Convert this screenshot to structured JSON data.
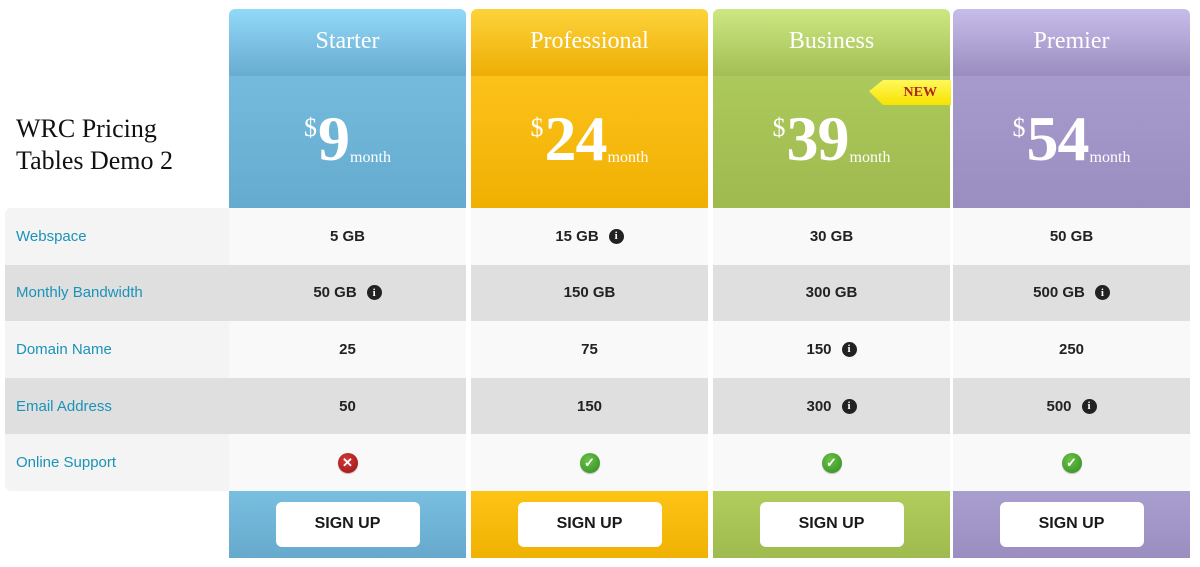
{
  "page": {
    "title": "WRC Pricing Tables Demo 2"
  },
  "features": [
    {
      "label": "Webspace"
    },
    {
      "label": "Monthly Bandwidth"
    },
    {
      "label": "Domain Name"
    },
    {
      "label": "Email Address"
    },
    {
      "label": "Online Support"
    }
  ],
  "plans": [
    {
      "name": "Starter",
      "currency": "$",
      "price": "9",
      "period": "month",
      "badge": "",
      "values": [
        {
          "text": "5 GB",
          "info": false
        },
        {
          "text": "50 GB",
          "info": true
        },
        {
          "text": "25",
          "info": false
        },
        {
          "text": "50",
          "info": false
        },
        {
          "status": "no"
        }
      ],
      "button_label": "SIGN UP"
    },
    {
      "name": "Professional",
      "currency": "$",
      "price": "24",
      "period": "month",
      "badge": "",
      "values": [
        {
          "text": "15 GB",
          "info": true
        },
        {
          "text": "150 GB",
          "info": false
        },
        {
          "text": "75",
          "info": false
        },
        {
          "text": "150",
          "info": false
        },
        {
          "status": "yes"
        }
      ],
      "button_label": "SIGN UP"
    },
    {
      "name": "Business",
      "currency": "$",
      "price": "39",
      "period": "month",
      "badge": "NEW",
      "values": [
        {
          "text": "30 GB",
          "info": false
        },
        {
          "text": "300 GB",
          "info": false
        },
        {
          "text": "150",
          "info": true
        },
        {
          "text": "300",
          "info": true
        },
        {
          "status": "yes"
        }
      ],
      "button_label": "SIGN UP"
    },
    {
      "name": "Premier",
      "currency": "$",
      "price": "54",
      "period": "month",
      "badge": "",
      "values": [
        {
          "text": "50 GB",
          "info": false
        },
        {
          "text": "500 GB",
          "info": true
        },
        {
          "text": "250",
          "info": false
        },
        {
          "text": "500",
          "info": true
        },
        {
          "status": "yes"
        }
      ],
      "button_label": "SIGN UP"
    }
  ],
  "icons": {
    "info": "i",
    "yes": "✓",
    "no": "✕"
  },
  "colors": {
    "label_text": "#1a93b8",
    "starter": "#6eb3d6",
    "professional": "#f5b80d",
    "business": "#a6c256",
    "premier": "#a196c6",
    "badge_bg": "#f9ec20",
    "badge_text": "#b0261a"
  }
}
